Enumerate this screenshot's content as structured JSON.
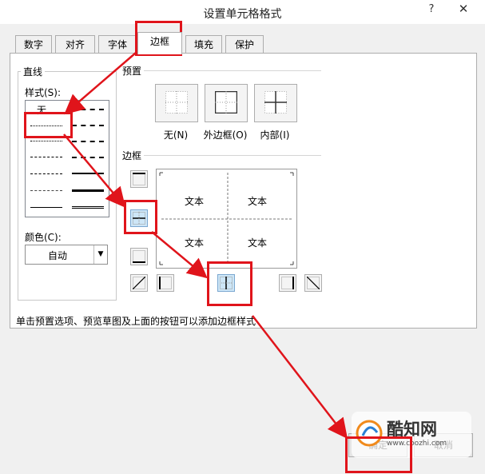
{
  "dialog": {
    "title": "设置单元格格式",
    "help_label": "?",
    "close_label": "✕"
  },
  "tabs": [
    {
      "label": "数字"
    },
    {
      "label": "对齐"
    },
    {
      "label": "字体"
    },
    {
      "label": "边框",
      "active": true
    },
    {
      "label": "填充"
    },
    {
      "label": "保护"
    }
  ],
  "line_group": {
    "title": "直线",
    "style_label": "样式(S):",
    "none_label": "无",
    "color_label": "颜色(C):",
    "color_value": "自动"
  },
  "presets": {
    "title": "预置",
    "items": [
      {
        "label": "无(N)"
      },
      {
        "label": "外边框(O)"
      },
      {
        "label": "内部(I)"
      }
    ]
  },
  "border": {
    "title": "边框",
    "preview_texts": [
      "文本",
      "文本",
      "文本",
      "文本"
    ]
  },
  "hint": "单击预置选项、预览草图及上面的按钮可以添加边框样式",
  "buttons": {
    "ok_label": "确定",
    "cancel_label": "取消"
  },
  "watermark": {
    "brand": "酷知网",
    "url": "www.coozhi.com"
  },
  "colors": {
    "annotation_red": "#e0141b",
    "selected_blue": "#cde6f7"
  }
}
